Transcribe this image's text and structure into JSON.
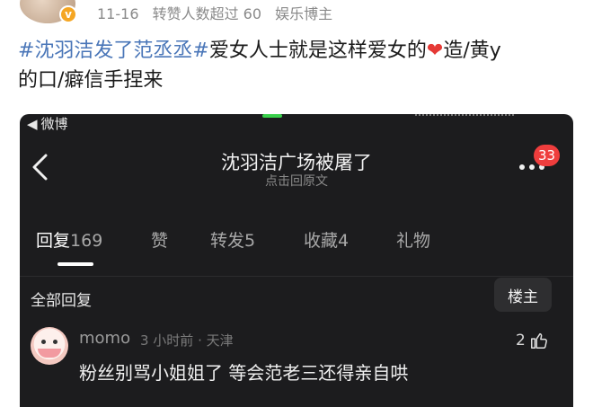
{
  "post": {
    "meta_date": "11-16",
    "meta_reposts": "转赞人数超过 60",
    "meta_role": "娱乐博主",
    "verified_badge": "v",
    "text_tag": "#沈羽洁发了范丞丞#",
    "text_part1": "爱女人士就是这样爱女的",
    "text_heart": "❤",
    "text_part2": "造/黄y",
    "text_line2": "的口/癖信手捏来"
  },
  "embed": {
    "status_app": "微博",
    "title": "沈羽洁广场被屠了",
    "subtitle": "点击回原文",
    "more_badge": "33",
    "tabs": [
      {
        "label": "回复",
        "count": "169"
      },
      {
        "label": "赞",
        "count": ""
      },
      {
        "label": "转发",
        "count": "5"
      },
      {
        "label": "收藏",
        "count": "4"
      },
      {
        "label": "礼物",
        "count": ""
      }
    ],
    "all_replies_label": "全部回复",
    "louzhu_label": "楼主",
    "comment": {
      "user": "momo",
      "meta": "3 小时前 · 天津",
      "likes": "2",
      "text": "粉丝别骂小姐姐了 等会范老三还得亲自哄"
    }
  },
  "icons": {
    "back": "chevron-left-icon",
    "more": "more-dots-icon",
    "like": "thumbs-up-icon"
  },
  "colors": {
    "tag": "#4a76b8",
    "heart": "#e53935",
    "badge": "#ef3d3d",
    "embed_bg": "#1c1c1e"
  }
}
